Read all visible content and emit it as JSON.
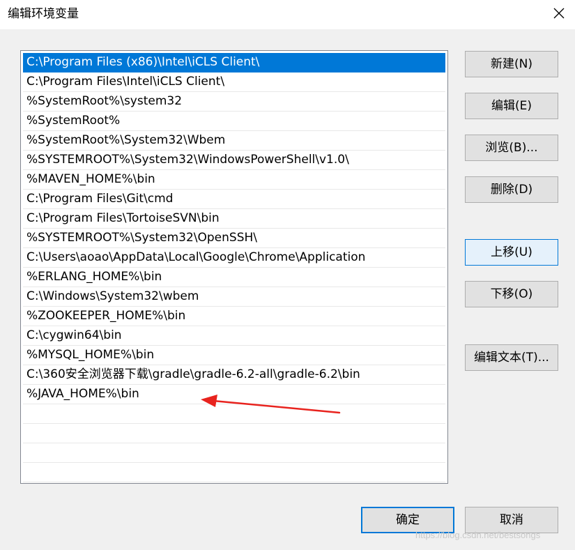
{
  "window": {
    "title": "编辑环境变量",
    "close_icon": "close-icon"
  },
  "list": {
    "selected_index": 0,
    "items": [
      "C:\\Program Files (x86)\\Intel\\iCLS Client\\",
      "C:\\Program Files\\Intel\\iCLS Client\\",
      "%SystemRoot%\\system32",
      "%SystemRoot%",
      "%SystemRoot%\\System32\\Wbem",
      "%SYSTEMROOT%\\System32\\WindowsPowerShell\\v1.0\\",
      "%MAVEN_HOME%\\bin",
      "C:\\Program Files\\Git\\cmd",
      "C:\\Program Files\\TortoiseSVN\\bin",
      "%SYSTEMROOT%\\System32\\OpenSSH\\",
      "C:\\Users\\aoao\\AppData\\Local\\Google\\Chrome\\Application",
      "%ERLANG_HOME%\\bin",
      "C:\\Windows\\System32\\wbem",
      "%ZOOKEEPER_HOME%\\bin",
      "C:\\cygwin64\\bin",
      "%MYSQL_HOME%\\bin",
      "C:\\360安全浏览器下载\\gradle\\gradle-6.2-all\\gradle-6.2\\bin",
      "%JAVA_HOME%\\bin"
    ],
    "empty_rows": 4
  },
  "buttons": {
    "new": "新建(N)",
    "edit": "编辑(E)",
    "browse": "浏览(B)...",
    "delete": "删除(D)",
    "move_up": "上移(U)",
    "move_down": "下移(O)",
    "edit_text": "编辑文本(T)...",
    "ok": "确定",
    "cancel": "取消"
  },
  "annotation": {
    "arrow_color": "#e8231e"
  },
  "watermark": "https://blog.csdn.net/bestsongs",
  "colors": {
    "selection": "#0078d7",
    "focus_border": "#0078d7",
    "button_face": "#e1e1e1"
  }
}
